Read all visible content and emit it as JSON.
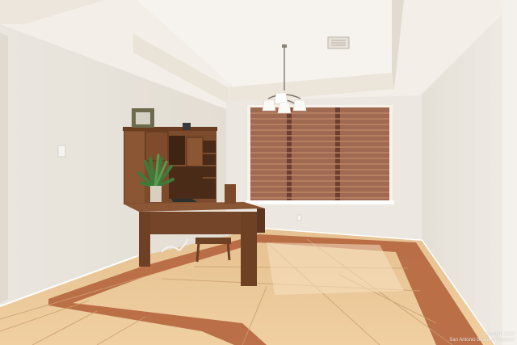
{
  "photo": {
    "watermark_line1": "Copyright 2024",
    "watermark_line2": "San Antonio Board of Realtors",
    "colors": {
      "wall": "#ece7df",
      "ceiling": "#f1ede6",
      "wood": "#7a4a2a",
      "tile": "#e2b27a",
      "tile_border": "#b7653b",
      "blind": "#a86e55"
    }
  }
}
